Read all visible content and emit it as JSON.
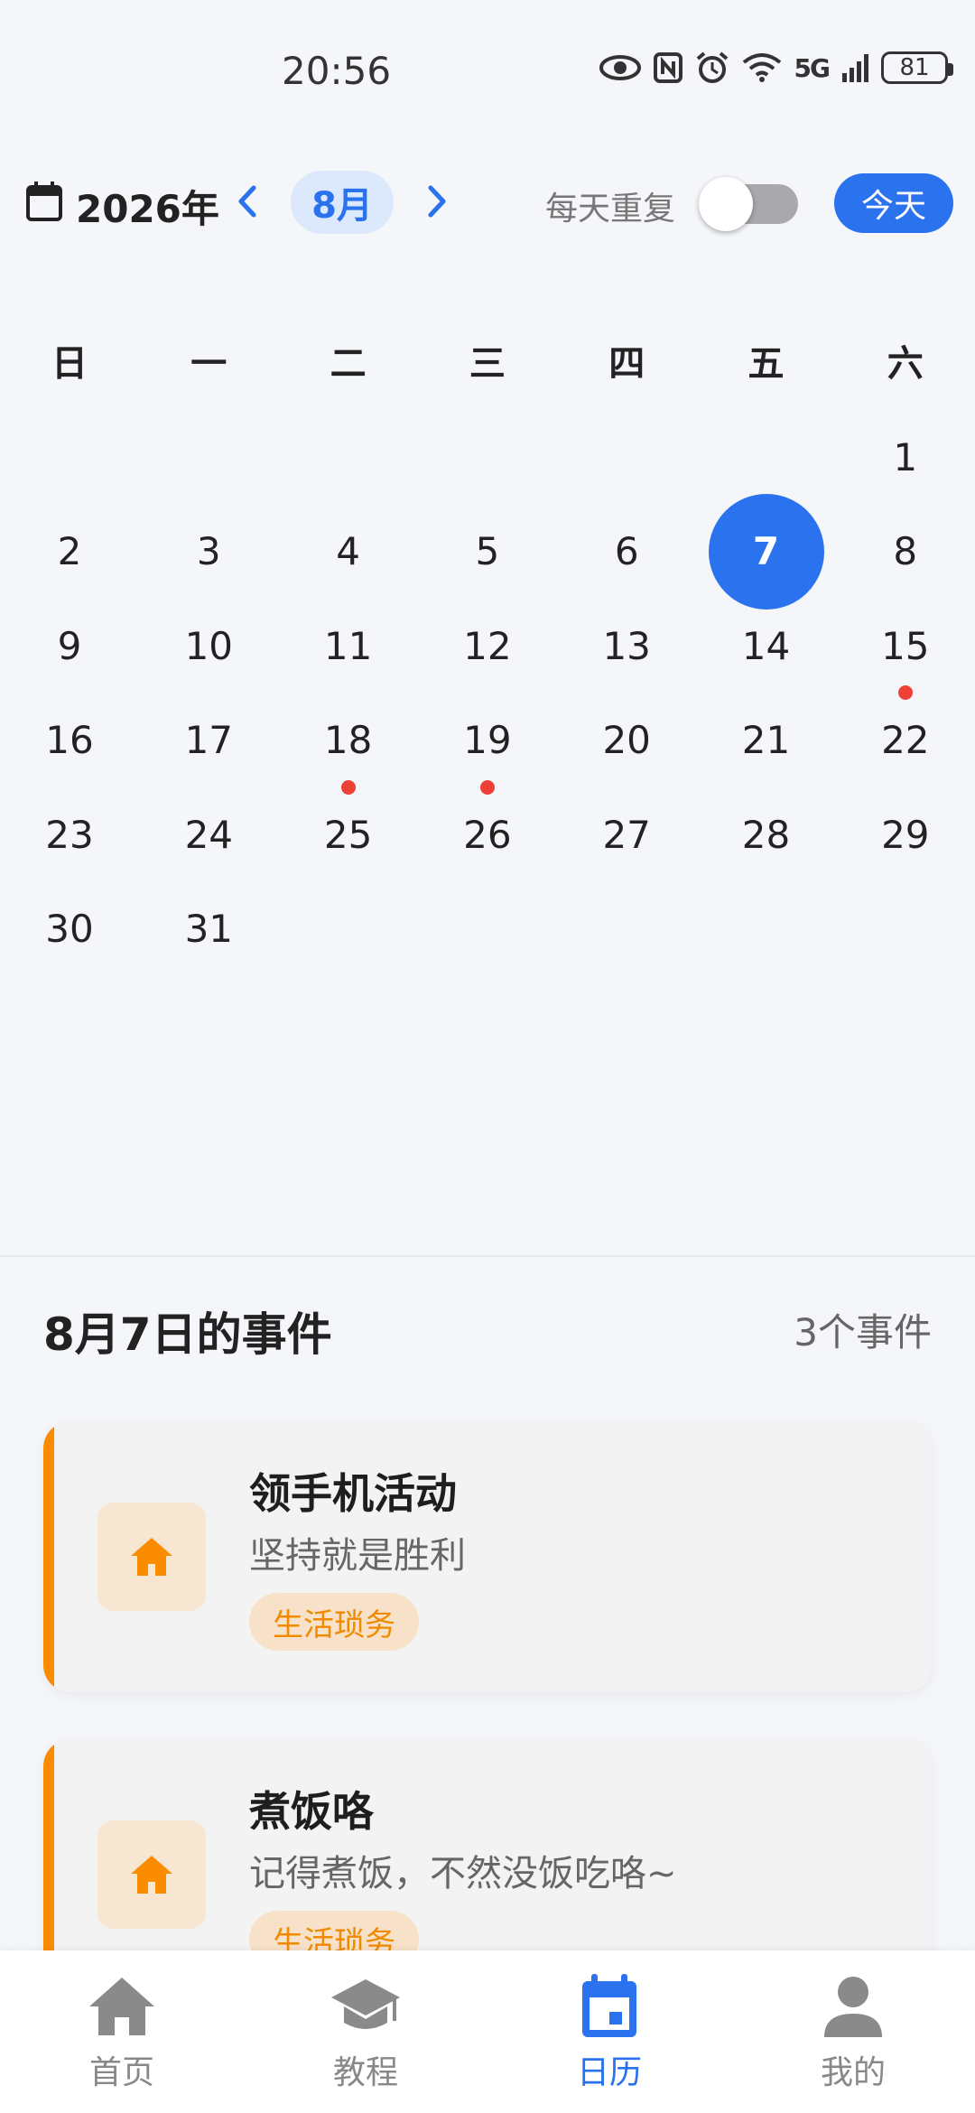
{
  "status_bar": {
    "time": "20:56",
    "network": "5G",
    "battery": "81",
    "icons": [
      "eye-icon",
      "nfc-icon",
      "alarm-icon",
      "wifi-icon",
      "signal-icon",
      "battery-icon"
    ]
  },
  "header": {
    "year": "2026年",
    "month": "8月",
    "repeat_label": "每天重复",
    "repeat_enabled": false,
    "today_label": "今天"
  },
  "weekdays": [
    "日",
    "一",
    "二",
    "三",
    "四",
    "五",
    "六"
  ],
  "calendar": {
    "first_weekday_index": 6,
    "days_in_month": 31,
    "selected_day": 7,
    "days_with_events": [
      15,
      18,
      19
    ]
  },
  "events_section": {
    "title": "8月7日的事件",
    "count": "3个事件"
  },
  "events": [
    {
      "title": "领手机活动",
      "desc": "坚持就是胜利",
      "tag": "生活琐务",
      "icon": "home-icon"
    },
    {
      "title": "煮饭咯",
      "desc": "记得煮饭，不然没饭吃咯~",
      "tag": "生活琐务",
      "icon": "home-icon"
    }
  ],
  "nav": [
    {
      "label": "首页",
      "icon": "home-icon",
      "active": false
    },
    {
      "label": "教程",
      "icon": "graduation-cap-icon",
      "active": false
    },
    {
      "label": "日历",
      "icon": "calendar-icon",
      "active": true
    },
    {
      "label": "我的",
      "icon": "person-icon",
      "active": false
    }
  ],
  "colors": {
    "accent": "#2a72ee",
    "event_dot": "#ee4036",
    "category_orange": "#fb8c00"
  }
}
